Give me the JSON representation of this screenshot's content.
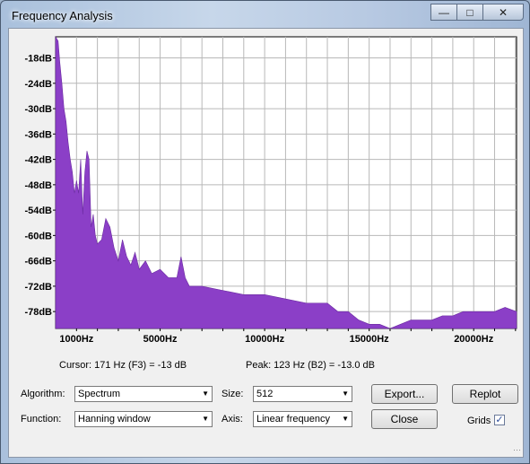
{
  "window": {
    "title": "Frequency Analysis"
  },
  "chart_data": {
    "type": "area",
    "title": "",
    "xlabel": "",
    "ylabel": "",
    "color": "#8b3fc7",
    "xlim": [
      0,
      22050
    ],
    "ylim": [
      -82,
      -13
    ],
    "x_ticks": [
      {
        "value": 1000,
        "label": "1000Hz"
      },
      {
        "value": 5000,
        "label": "5000Hz"
      },
      {
        "value": 10000,
        "label": "10000Hz"
      },
      {
        "value": 15000,
        "label": "15000Hz"
      },
      {
        "value": 20000,
        "label": "20000Hz"
      }
    ],
    "y_ticks": [
      {
        "value": -18,
        "label": "-18dB"
      },
      {
        "value": -24,
        "label": "-24dB"
      },
      {
        "value": -30,
        "label": "-30dB"
      },
      {
        "value": -36,
        "label": "-36dB"
      },
      {
        "value": -42,
        "label": "-42dB"
      },
      {
        "value": -48,
        "label": "-48dB"
      },
      {
        "value": -54,
        "label": "-54dB"
      },
      {
        "value": -60,
        "label": "-60dB"
      },
      {
        "value": -66,
        "label": "-66dB"
      },
      {
        "value": -72,
        "label": "-72dB"
      },
      {
        "value": -78,
        "label": "-78dB"
      }
    ],
    "grid": true,
    "x": [
      0,
      120,
      200,
      300,
      400,
      500,
      600,
      700,
      800,
      900,
      1000,
      1100,
      1200,
      1300,
      1400,
      1500,
      1600,
      1700,
      1800,
      1900,
      2000,
      2200,
      2400,
      2600,
      2800,
      3000,
      3200,
      3400,
      3600,
      3800,
      4000,
      4300,
      4600,
      5000,
      5400,
      5800,
      6000,
      6200,
      6400,
      7000,
      8000,
      9000,
      10000,
      11000,
      12000,
      13000,
      13500,
      14000,
      14500,
      15000,
      15500,
      16000,
      16500,
      17000,
      17500,
      18000,
      18500,
      19000,
      19500,
      20000,
      20500,
      21000,
      21500,
      22050
    ],
    "y": [
      -13,
      -14,
      -19,
      -24,
      -30,
      -33,
      -38,
      -42,
      -45,
      -50,
      -47,
      -50,
      -42,
      -55,
      -45,
      -40,
      -42,
      -58,
      -55,
      -60,
      -62,
      -61,
      -56,
      -58,
      -63,
      -66,
      -61,
      -65,
      -67,
      -64,
      -68,
      -66,
      -69,
      -68,
      -70,
      -70,
      -65,
      -70,
      -72,
      -72,
      -73,
      -74,
      -74,
      -75,
      -76,
      -76,
      -78,
      -78,
      -80,
      -81,
      -81,
      -82,
      -81,
      -80,
      -80,
      -80,
      -79,
      -79,
      -78,
      -78,
      -78,
      -78,
      -77,
      -78
    ]
  },
  "info": {
    "cursor": "Cursor: 171 Hz (F3) = -13 dB",
    "peak": "Peak: 123 Hz (B2) = -13.0 dB"
  },
  "controls": {
    "algorithm_label": "Algorithm:",
    "algorithm_value": "Spectrum",
    "size_label": "Size:",
    "size_value": "512",
    "export_button": "Export...",
    "replot_button": "Replot",
    "function_label": "Function:",
    "function_value": "Hanning window",
    "axis_label": "Axis:",
    "axis_value": "Linear frequency",
    "close_button": "Close",
    "grids_label": "Grids",
    "grids_checked": true
  }
}
